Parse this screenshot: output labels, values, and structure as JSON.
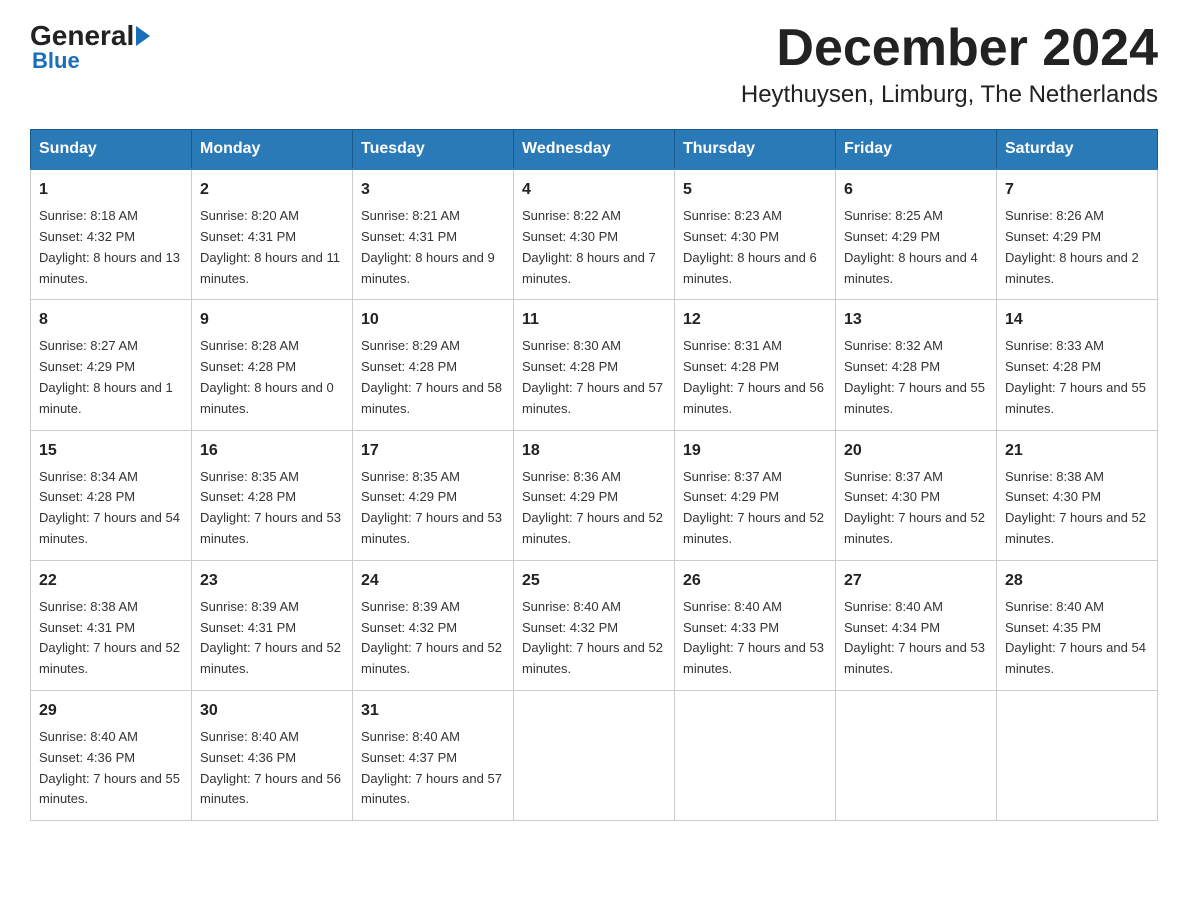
{
  "logo": {
    "general": "General",
    "blue": "Blue"
  },
  "header": {
    "title": "December 2024",
    "subtitle": "Heythuysen, Limburg, The Netherlands"
  },
  "weekdays": [
    "Sunday",
    "Monday",
    "Tuesday",
    "Wednesday",
    "Thursday",
    "Friday",
    "Saturday"
  ],
  "weeks": [
    [
      {
        "day": "1",
        "sunrise": "8:18 AM",
        "sunset": "4:32 PM",
        "daylight": "8 hours and 13 minutes."
      },
      {
        "day": "2",
        "sunrise": "8:20 AM",
        "sunset": "4:31 PM",
        "daylight": "8 hours and 11 minutes."
      },
      {
        "day": "3",
        "sunrise": "8:21 AM",
        "sunset": "4:31 PM",
        "daylight": "8 hours and 9 minutes."
      },
      {
        "day": "4",
        "sunrise": "8:22 AM",
        "sunset": "4:30 PM",
        "daylight": "8 hours and 7 minutes."
      },
      {
        "day": "5",
        "sunrise": "8:23 AM",
        "sunset": "4:30 PM",
        "daylight": "8 hours and 6 minutes."
      },
      {
        "day": "6",
        "sunrise": "8:25 AM",
        "sunset": "4:29 PM",
        "daylight": "8 hours and 4 minutes."
      },
      {
        "day": "7",
        "sunrise": "8:26 AM",
        "sunset": "4:29 PM",
        "daylight": "8 hours and 2 minutes."
      }
    ],
    [
      {
        "day": "8",
        "sunrise": "8:27 AM",
        "sunset": "4:29 PM",
        "daylight": "8 hours and 1 minute."
      },
      {
        "day": "9",
        "sunrise": "8:28 AM",
        "sunset": "4:28 PM",
        "daylight": "8 hours and 0 minutes."
      },
      {
        "day": "10",
        "sunrise": "8:29 AM",
        "sunset": "4:28 PM",
        "daylight": "7 hours and 58 minutes."
      },
      {
        "day": "11",
        "sunrise": "8:30 AM",
        "sunset": "4:28 PM",
        "daylight": "7 hours and 57 minutes."
      },
      {
        "day": "12",
        "sunrise": "8:31 AM",
        "sunset": "4:28 PM",
        "daylight": "7 hours and 56 minutes."
      },
      {
        "day": "13",
        "sunrise": "8:32 AM",
        "sunset": "4:28 PM",
        "daylight": "7 hours and 55 minutes."
      },
      {
        "day": "14",
        "sunrise": "8:33 AM",
        "sunset": "4:28 PM",
        "daylight": "7 hours and 55 minutes."
      }
    ],
    [
      {
        "day": "15",
        "sunrise": "8:34 AM",
        "sunset": "4:28 PM",
        "daylight": "7 hours and 54 minutes."
      },
      {
        "day": "16",
        "sunrise": "8:35 AM",
        "sunset": "4:28 PM",
        "daylight": "7 hours and 53 minutes."
      },
      {
        "day": "17",
        "sunrise": "8:35 AM",
        "sunset": "4:29 PM",
        "daylight": "7 hours and 53 minutes."
      },
      {
        "day": "18",
        "sunrise": "8:36 AM",
        "sunset": "4:29 PM",
        "daylight": "7 hours and 52 minutes."
      },
      {
        "day": "19",
        "sunrise": "8:37 AM",
        "sunset": "4:29 PM",
        "daylight": "7 hours and 52 minutes."
      },
      {
        "day": "20",
        "sunrise": "8:37 AM",
        "sunset": "4:30 PM",
        "daylight": "7 hours and 52 minutes."
      },
      {
        "day": "21",
        "sunrise": "8:38 AM",
        "sunset": "4:30 PM",
        "daylight": "7 hours and 52 minutes."
      }
    ],
    [
      {
        "day": "22",
        "sunrise": "8:38 AM",
        "sunset": "4:31 PM",
        "daylight": "7 hours and 52 minutes."
      },
      {
        "day": "23",
        "sunrise": "8:39 AM",
        "sunset": "4:31 PM",
        "daylight": "7 hours and 52 minutes."
      },
      {
        "day": "24",
        "sunrise": "8:39 AM",
        "sunset": "4:32 PM",
        "daylight": "7 hours and 52 minutes."
      },
      {
        "day": "25",
        "sunrise": "8:40 AM",
        "sunset": "4:32 PM",
        "daylight": "7 hours and 52 minutes."
      },
      {
        "day": "26",
        "sunrise": "8:40 AM",
        "sunset": "4:33 PM",
        "daylight": "7 hours and 53 minutes."
      },
      {
        "day": "27",
        "sunrise": "8:40 AM",
        "sunset": "4:34 PM",
        "daylight": "7 hours and 53 minutes."
      },
      {
        "day": "28",
        "sunrise": "8:40 AM",
        "sunset": "4:35 PM",
        "daylight": "7 hours and 54 minutes."
      }
    ],
    [
      {
        "day": "29",
        "sunrise": "8:40 AM",
        "sunset": "4:36 PM",
        "daylight": "7 hours and 55 minutes."
      },
      {
        "day": "30",
        "sunrise": "8:40 AM",
        "sunset": "4:36 PM",
        "daylight": "7 hours and 56 minutes."
      },
      {
        "day": "31",
        "sunrise": "8:40 AM",
        "sunset": "4:37 PM",
        "daylight": "7 hours and 57 minutes."
      },
      null,
      null,
      null,
      null
    ]
  ]
}
